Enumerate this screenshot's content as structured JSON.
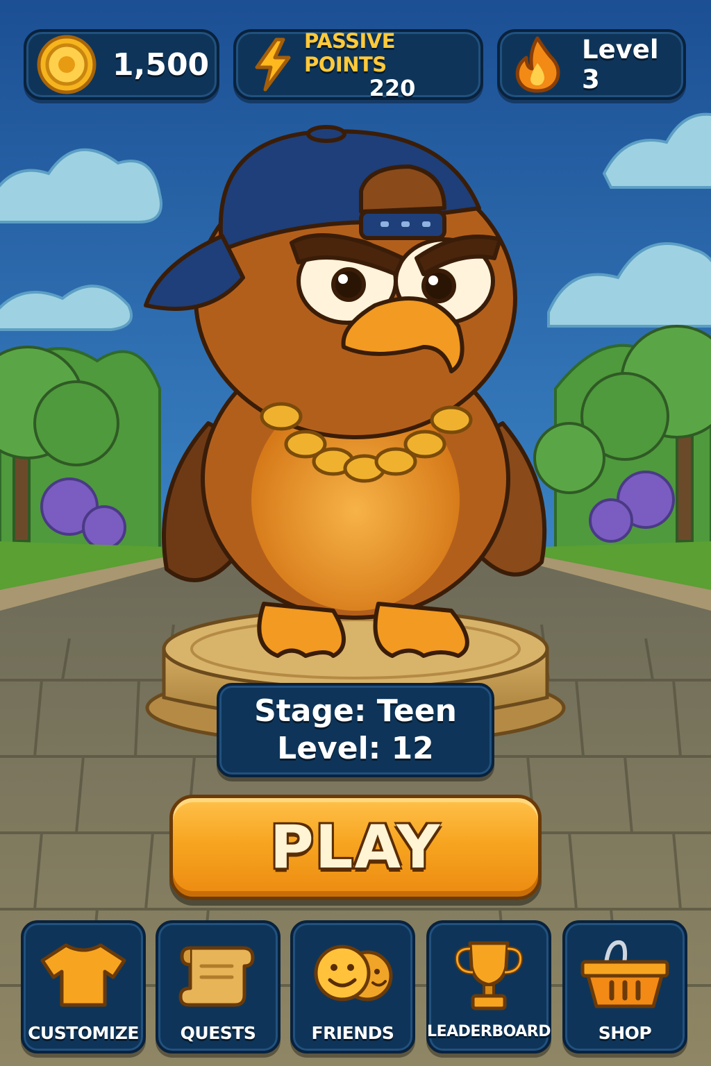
{
  "hud": {
    "coins": {
      "icon": "coin-icon",
      "value": "1,500"
    },
    "passive_points": {
      "icon": "lightning-icon",
      "label": "PASSIVE POINTS",
      "value": "220"
    },
    "level": {
      "icon": "flame-icon",
      "label": "Level 3"
    }
  },
  "character": {
    "description_icon": "eagle-mascot",
    "stage_label": "Stage: Teen",
    "level_label": "Level: 12"
  },
  "play_button": {
    "label": "PLAY"
  },
  "nav": [
    {
      "label": "CUSTOMIZE",
      "icon": "tshirt-icon"
    },
    {
      "label": "QUESTS",
      "icon": "scroll-icon"
    },
    {
      "label": "FRIENDS",
      "icon": "friends-icon"
    },
    {
      "label": "LEADERBOARD",
      "icon": "trophy-icon"
    },
    {
      "label": "SHOP",
      "icon": "basket-icon"
    }
  ],
  "colors": {
    "panel": "#0e3559",
    "accent_gold": "#ffc93a",
    "play_orange": "#f7a521",
    "sky": "#2f6fb3"
  }
}
